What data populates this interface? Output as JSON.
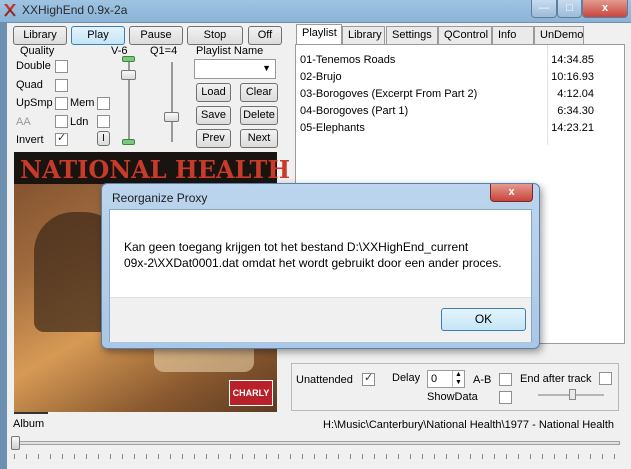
{
  "window": {
    "title": "XXHighEnd 0.9x-2a",
    "min": "—",
    "max": "□",
    "close": "x"
  },
  "transport": {
    "library": "Library",
    "play": "Play",
    "pause": "Pause",
    "stop": "Stop",
    "off": "Off"
  },
  "quality": {
    "label": "Quality",
    "v6": "V-6",
    "q1": "Q1=4",
    "double": "Double",
    "quad": "Quad",
    "upsmp": "UpSmp",
    "mem": "Mem",
    "aa": "AA",
    "ldn": "Ldn",
    "invert": "Invert",
    "i_btn": "I"
  },
  "playlist_name": {
    "label": "Playlist Name",
    "load": "Load",
    "clear": "Clear",
    "save": "Save",
    "delete": "Delete",
    "prev": "Prev",
    "next": "Next"
  },
  "tabs": [
    "Playlist",
    "Library",
    "Settings",
    "QControl",
    "Info",
    "UnDemo"
  ],
  "tracks": [
    {
      "title": "01-Tenemos Roads",
      "duration": "14:34.85"
    },
    {
      "title": "02-Brujo",
      "duration": "10:16.93"
    },
    {
      "title": "03-Borogoves (Excerpt From Part 2)",
      "duration": "4:12.04"
    },
    {
      "title": "04-Borogoves (Part 1)",
      "duration": "6:34.30"
    },
    {
      "title": "05-Elephants",
      "duration": "14:23.21"
    }
  ],
  "album_art": {
    "band_text": "NATIONAL HEALTH",
    "label_text": "CHARLY"
  },
  "dialog": {
    "title": "Reorganize Proxy",
    "close": "x",
    "line1": "Kan geen toegang krijgen tot het bestand D:\\XXHighEnd_current",
    "line2": "09x-2\\XXDat0001.dat omdat het wordt gebruikt door een ander proces.",
    "ok": "OK"
  },
  "controls": {
    "unattended": "Unattended",
    "delay": "Delay",
    "delay_value": "0",
    "ab": "A-B",
    "end_after_track": "End after track",
    "showdata": "ShowData"
  },
  "album": {
    "label": "Album",
    "path": "H:\\Music\\Canterbury\\National Health\\1977 - National Health"
  },
  "colors": {
    "accent": "#3c7fb1",
    "titlebar": "#8ab3d6",
    "close_red": "#c9463d"
  }
}
